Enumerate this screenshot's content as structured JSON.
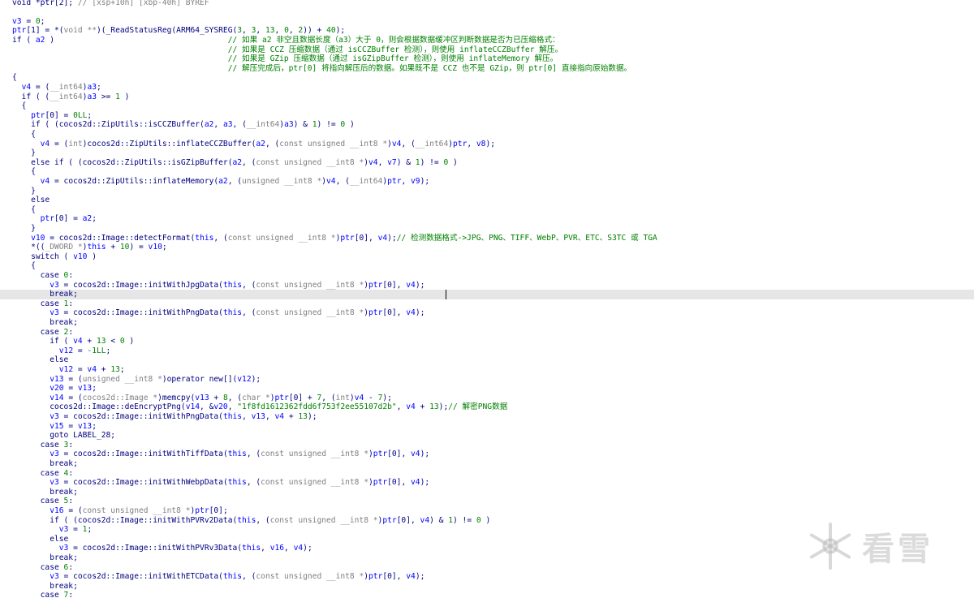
{
  "watermark": {
    "text": "看雪",
    "icon": "snowflake-icon"
  },
  "code_lines": [
    [
      [
        "k",
        "void *ptr[2]; "
      ],
      [
        "t",
        "// [xsp+10h] [xbp-40h] BYREF"
      ]
    ],
    [],
    [
      [
        "v",
        "v3"
      ],
      [
        "k",
        " = "
      ],
      [
        "n",
        "0"
      ],
      [
        "k",
        ";"
      ]
    ],
    [
      [
        "v",
        "ptr"
      ],
      [
        "k",
        "[1] = *("
      ],
      [
        "t",
        "void **"
      ],
      [
        "k",
        ")(_ReadStatusReg(ARM64_SYSREG("
      ],
      [
        "n",
        "3"
      ],
      [
        "k",
        ", "
      ],
      [
        "n",
        "3"
      ],
      [
        "k",
        ", "
      ],
      [
        "n",
        "13"
      ],
      [
        "k",
        ", "
      ],
      [
        "n",
        "0"
      ],
      [
        "k",
        ", "
      ],
      [
        "n",
        "2"
      ],
      [
        "k",
        ")) + "
      ],
      [
        "n",
        "40"
      ],
      [
        "k",
        ");"
      ]
    ],
    [
      [
        "k",
        "if ( "
      ],
      [
        "v",
        "a2"
      ],
      [
        "k",
        " )                                     "
      ],
      [
        "c",
        "// 如果 a2 非空且数据长度（a3）大于 0，则会根据数据缓冲区判断数据是否为已压缩格式："
      ]
    ],
    [
      [
        "k",
        "                                              "
      ],
      [
        "c",
        "// 如果是 CCZ 压缩数据（通过 isCCZBuffer 检测），则使用 inflateCCZBuffer 解压。"
      ]
    ],
    [
      [
        "k",
        "                                              "
      ],
      [
        "c",
        "// 如果是 GZip 压缩数据（通过 isGZipBuffer 检测），则使用 inflateMemory 解压。"
      ]
    ],
    [
      [
        "k",
        "                                              "
      ],
      [
        "c",
        "// 解压完成后，ptr[0] 将指向解压后的数据。如果既不是 CCZ 也不是 GZip，则 ptr[0] 直接指向原始数据。"
      ]
    ],
    [
      [
        "k",
        "{"
      ]
    ],
    [
      [
        "k",
        "  "
      ],
      [
        "v",
        "v4"
      ],
      [
        "k",
        " = ("
      ],
      [
        "t",
        "__int64"
      ],
      [
        "k",
        ")"
      ],
      [
        "v",
        "a3"
      ],
      [
        "k",
        ";"
      ]
    ],
    [
      [
        "k",
        "  if ( ("
      ],
      [
        "t",
        "__int64"
      ],
      [
        "k",
        ")"
      ],
      [
        "v",
        "a3"
      ],
      [
        "k",
        " >= "
      ],
      [
        "n",
        "1"
      ],
      [
        "k",
        " )"
      ]
    ],
    [
      [
        "k",
        "  {"
      ]
    ],
    [
      [
        "k",
        "    "
      ],
      [
        "v",
        "ptr"
      ],
      [
        "k",
        "[0] = "
      ],
      [
        "n",
        "0LL"
      ],
      [
        "k",
        ";"
      ]
    ],
    [
      [
        "k",
        "    if ( (cocos2d::ZipUtils::isCCZBuffer("
      ],
      [
        "v",
        "a2"
      ],
      [
        "k",
        ", "
      ],
      [
        "v",
        "a3"
      ],
      [
        "k",
        ", ("
      ],
      [
        "t",
        "__int64"
      ],
      [
        "k",
        ")"
      ],
      [
        "v",
        "a3"
      ],
      [
        "k",
        ") & "
      ],
      [
        "n",
        "1"
      ],
      [
        "k",
        ") != "
      ],
      [
        "n",
        "0"
      ],
      [
        "k",
        " )"
      ]
    ],
    [
      [
        "k",
        "    {"
      ]
    ],
    [
      [
        "k",
        "      "
      ],
      [
        "v",
        "v4"
      ],
      [
        "k",
        " = ("
      ],
      [
        "t",
        "int"
      ],
      [
        "k",
        ")cocos2d::ZipUtils::inflateCCZBuffer("
      ],
      [
        "v",
        "a2"
      ],
      [
        "k",
        ", ("
      ],
      [
        "t",
        "const unsigned __int8 *"
      ],
      [
        "k",
        ")"
      ],
      [
        "v",
        "v4"
      ],
      [
        "k",
        ", ("
      ],
      [
        "t",
        "__int64"
      ],
      [
        "k",
        ")"
      ],
      [
        "v",
        "ptr"
      ],
      [
        "k",
        ", "
      ],
      [
        "v",
        "v8"
      ],
      [
        "k",
        ");"
      ]
    ],
    [
      [
        "k",
        "    }"
      ]
    ],
    [
      [
        "k",
        "    else if ( (cocos2d::ZipUtils::isGZipBuffer("
      ],
      [
        "v",
        "a2"
      ],
      [
        "k",
        ", ("
      ],
      [
        "t",
        "const unsigned __int8 *"
      ],
      [
        "k",
        ")"
      ],
      [
        "v",
        "v4"
      ],
      [
        "k",
        ", "
      ],
      [
        "v",
        "v7"
      ],
      [
        "k",
        ") & "
      ],
      [
        "n",
        "1"
      ],
      [
        "k",
        ") != "
      ],
      [
        "n",
        "0"
      ],
      [
        "k",
        " )"
      ]
    ],
    [
      [
        "k",
        "    {"
      ]
    ],
    [
      [
        "k",
        "      "
      ],
      [
        "v",
        "v4"
      ],
      [
        "k",
        " = cocos2d::ZipUtils::inflateMemory("
      ],
      [
        "v",
        "a2"
      ],
      [
        "k",
        ", ("
      ],
      [
        "t",
        "unsigned __int8 *"
      ],
      [
        "k",
        ")"
      ],
      [
        "v",
        "v4"
      ],
      [
        "k",
        ", ("
      ],
      [
        "t",
        "__int64"
      ],
      [
        "k",
        ")"
      ],
      [
        "v",
        "ptr"
      ],
      [
        "k",
        ", "
      ],
      [
        "v",
        "v9"
      ],
      [
        "k",
        ");"
      ]
    ],
    [
      [
        "k",
        "    }"
      ]
    ],
    [
      [
        "k",
        "    else"
      ]
    ],
    [
      [
        "k",
        "    {"
      ]
    ],
    [
      [
        "k",
        "      "
      ],
      [
        "v",
        "ptr"
      ],
      [
        "k",
        "[0] = "
      ],
      [
        "v",
        "a2"
      ],
      [
        "k",
        ";"
      ]
    ],
    [
      [
        "k",
        "    }"
      ]
    ],
    [
      [
        "k",
        "    "
      ],
      [
        "v",
        "v10"
      ],
      [
        "k",
        " = cocos2d::Image::detectFormat("
      ],
      [
        "v",
        "this"
      ],
      [
        "k",
        ", ("
      ],
      [
        "t",
        "const unsigned __int8 *"
      ],
      [
        "k",
        ")"
      ],
      [
        "v",
        "ptr"
      ],
      [
        "k",
        "[0], "
      ],
      [
        "v",
        "v4"
      ],
      [
        "k",
        ");"
      ],
      [
        "c",
        "// 检测数据格式->JPG、PNG、TIFF、WebP、PVR、ETC、S3TC 或 TGA"
      ]
    ],
    [
      [
        "k",
        "    *(("
      ],
      [
        "t",
        "_DWORD *"
      ],
      [
        "k",
        ")"
      ],
      [
        "v",
        "this"
      ],
      [
        "k",
        " + "
      ],
      [
        "n",
        "10"
      ],
      [
        "k",
        ") = "
      ],
      [
        "v",
        "v10"
      ],
      [
        "k",
        ";"
      ]
    ],
    [
      [
        "k",
        "    switch ( "
      ],
      [
        "v",
        "v10"
      ],
      [
        "k",
        " )"
      ]
    ],
    [
      [
        "k",
        "    {"
      ]
    ],
    [
      [
        "k",
        "      case "
      ],
      [
        "n",
        "0"
      ],
      [
        "k",
        ":"
      ]
    ],
    [
      [
        "k",
        "        "
      ],
      [
        "v",
        "v3"
      ],
      [
        "k",
        " = cocos2d::Image::initWithJpgData("
      ],
      [
        "v",
        "this"
      ],
      [
        "k",
        ", ("
      ],
      [
        "t",
        "const unsigned __int8 *"
      ],
      [
        "k",
        ")"
      ],
      [
        "v",
        "ptr"
      ],
      [
        "k",
        "[0], "
      ],
      [
        "v",
        "v4"
      ],
      [
        "k",
        ");"
      ]
    ],
    [
      [
        "k",
        "        break;"
      ]
    ],
    [
      [
        "k",
        "      case "
      ],
      [
        "n",
        "1"
      ],
      [
        "k",
        ":"
      ]
    ],
    [
      [
        "k",
        "        "
      ],
      [
        "v",
        "v3"
      ],
      [
        "k",
        " = cocos2d::Image::initWithPngData("
      ],
      [
        "v",
        "this"
      ],
      [
        "k",
        ", ("
      ],
      [
        "t",
        "const unsigned __int8 *"
      ],
      [
        "k",
        ")"
      ],
      [
        "v",
        "ptr"
      ],
      [
        "k",
        "[0], "
      ],
      [
        "v",
        "v4"
      ],
      [
        "k",
        ");"
      ]
    ],
    [
      [
        "k",
        "        break;"
      ]
    ],
    [
      [
        "k",
        "      case "
      ],
      [
        "n",
        "2"
      ],
      [
        "k",
        ":"
      ]
    ],
    [
      [
        "k",
        "        if ( "
      ],
      [
        "v",
        "v4"
      ],
      [
        "k",
        " + "
      ],
      [
        "n",
        "13"
      ],
      [
        "k",
        " < "
      ],
      [
        "n",
        "0"
      ],
      [
        "k",
        " )"
      ]
    ],
    [
      [
        "k",
        "          "
      ],
      [
        "v",
        "v12"
      ],
      [
        "k",
        " = "
      ],
      [
        "n",
        "-1LL"
      ],
      [
        "k",
        ";"
      ]
    ],
    [
      [
        "k",
        "        else"
      ]
    ],
    [
      [
        "k",
        "          "
      ],
      [
        "v",
        "v12"
      ],
      [
        "k",
        " = "
      ],
      [
        "v",
        "v4"
      ],
      [
        "k",
        " + "
      ],
      [
        "n",
        "13"
      ],
      [
        "k",
        ";"
      ]
    ],
    [
      [
        "k",
        "        "
      ],
      [
        "v",
        "v13"
      ],
      [
        "k",
        " = ("
      ],
      [
        "t",
        "unsigned __int8 *"
      ],
      [
        "k",
        ")operator new[]("
      ],
      [
        "v",
        "v12"
      ],
      [
        "k",
        ");"
      ]
    ],
    [
      [
        "k",
        "        "
      ],
      [
        "v",
        "v20"
      ],
      [
        "k",
        " = "
      ],
      [
        "v",
        "v13"
      ],
      [
        "k",
        ";"
      ]
    ],
    [
      [
        "k",
        "        "
      ],
      [
        "v",
        "v14"
      ],
      [
        "k",
        " = ("
      ],
      [
        "t",
        "cocos2d::Image *"
      ],
      [
        "k",
        ")memcpy("
      ],
      [
        "v",
        "v13"
      ],
      [
        "k",
        " + "
      ],
      [
        "n",
        "8"
      ],
      [
        "k",
        ", ("
      ],
      [
        "t",
        "char *"
      ],
      [
        "k",
        ")"
      ],
      [
        "v",
        "ptr"
      ],
      [
        "k",
        "[0] + "
      ],
      [
        "n",
        "7"
      ],
      [
        "k",
        ", ("
      ],
      [
        "t",
        "int"
      ],
      [
        "k",
        ")"
      ],
      [
        "v",
        "v4"
      ],
      [
        "k",
        " - "
      ],
      [
        "n",
        "7"
      ],
      [
        "k",
        ");"
      ]
    ],
    [
      [
        "k",
        "        cocos2d::Image::deEncryptPng("
      ],
      [
        "v",
        "v14"
      ],
      [
        "k",
        ", &"
      ],
      [
        "v",
        "v20"
      ],
      [
        "k",
        ", "
      ],
      [
        "s",
        "\"1f8fd1612362fdd6f753f2ee55107d2b\""
      ],
      [
        "k",
        ", "
      ],
      [
        "v",
        "v4"
      ],
      [
        "k",
        " + "
      ],
      [
        "n",
        "13"
      ],
      [
        "k",
        ");"
      ],
      [
        "c",
        "// 解密PNG数据"
      ]
    ],
    [
      [
        "k",
        "        "
      ],
      [
        "v",
        "v3"
      ],
      [
        "k",
        " = cocos2d::Image::initWithPngData("
      ],
      [
        "v",
        "this"
      ],
      [
        "k",
        ", "
      ],
      [
        "v",
        "v13"
      ],
      [
        "k",
        ", "
      ],
      [
        "v",
        "v4"
      ],
      [
        "k",
        " + "
      ],
      [
        "n",
        "13"
      ],
      [
        "k",
        ");"
      ]
    ],
    [
      [
        "k",
        "        "
      ],
      [
        "v",
        "v15"
      ],
      [
        "k",
        " = "
      ],
      [
        "v",
        "v13"
      ],
      [
        "k",
        ";"
      ]
    ],
    [
      [
        "k",
        "        goto LABEL_28;"
      ]
    ],
    [
      [
        "k",
        "      case "
      ],
      [
        "n",
        "3"
      ],
      [
        "k",
        ":"
      ]
    ],
    [
      [
        "k",
        "        "
      ],
      [
        "v",
        "v3"
      ],
      [
        "k",
        " = cocos2d::Image::initWithTiffData("
      ],
      [
        "v",
        "this"
      ],
      [
        "k",
        ", ("
      ],
      [
        "t",
        "const unsigned __int8 *"
      ],
      [
        "k",
        ")"
      ],
      [
        "v",
        "ptr"
      ],
      [
        "k",
        "[0], "
      ],
      [
        "v",
        "v4"
      ],
      [
        "k",
        ");"
      ]
    ],
    [
      [
        "k",
        "        break;"
      ]
    ],
    [
      [
        "k",
        "      case "
      ],
      [
        "n",
        "4"
      ],
      [
        "k",
        ":"
      ]
    ],
    [
      [
        "k",
        "        "
      ],
      [
        "v",
        "v3"
      ],
      [
        "k",
        " = cocos2d::Image::initWithWebpData("
      ],
      [
        "v",
        "this"
      ],
      [
        "k",
        ", ("
      ],
      [
        "t",
        "const unsigned __int8 *"
      ],
      [
        "k",
        ")"
      ],
      [
        "v",
        "ptr"
      ],
      [
        "k",
        "[0], "
      ],
      [
        "v",
        "v4"
      ],
      [
        "k",
        ");"
      ]
    ],
    [
      [
        "k",
        "        break;"
      ]
    ],
    [
      [
        "k",
        "      case "
      ],
      [
        "n",
        "5"
      ],
      [
        "k",
        ":"
      ]
    ],
    [
      [
        "k",
        "        "
      ],
      [
        "v",
        "v16"
      ],
      [
        "k",
        " = ("
      ],
      [
        "t",
        "const unsigned __int8 *"
      ],
      [
        "k",
        ")"
      ],
      [
        "v",
        "ptr"
      ],
      [
        "k",
        "[0];"
      ]
    ],
    [
      [
        "k",
        "        if ( (cocos2d::Image::initWithPVRv2Data("
      ],
      [
        "v",
        "this"
      ],
      [
        "k",
        ", ("
      ],
      [
        "t",
        "const unsigned __int8 *"
      ],
      [
        "k",
        ")"
      ],
      [
        "v",
        "ptr"
      ],
      [
        "k",
        "[0], "
      ],
      [
        "v",
        "v4"
      ],
      [
        "k",
        ") & "
      ],
      [
        "n",
        "1"
      ],
      [
        "k",
        ") != "
      ],
      [
        "n",
        "0"
      ],
      [
        "k",
        " )"
      ]
    ],
    [
      [
        "k",
        "          "
      ],
      [
        "v",
        "v3"
      ],
      [
        "k",
        " = "
      ],
      [
        "n",
        "1"
      ],
      [
        "k",
        ";"
      ]
    ],
    [
      [
        "k",
        "        else"
      ]
    ],
    [
      [
        "k",
        "          "
      ],
      [
        "v",
        "v3"
      ],
      [
        "k",
        " = cocos2d::Image::initWithPVRv3Data("
      ],
      [
        "v",
        "this"
      ],
      [
        "k",
        ", "
      ],
      [
        "v",
        "v16"
      ],
      [
        "k",
        ", "
      ],
      [
        "v",
        "v4"
      ],
      [
        "k",
        ");"
      ]
    ],
    [
      [
        "k",
        "        break;"
      ]
    ],
    [
      [
        "k",
        "      case "
      ],
      [
        "n",
        "6"
      ],
      [
        "k",
        ":"
      ]
    ],
    [
      [
        "k",
        "        "
      ],
      [
        "v",
        "v3"
      ],
      [
        "k",
        " = cocos2d::Image::initWithETCData("
      ],
      [
        "v",
        "this"
      ],
      [
        "k",
        ", ("
      ],
      [
        "t",
        "const unsigned __int8 *"
      ],
      [
        "k",
        ")"
      ],
      [
        "v",
        "ptr"
      ],
      [
        "k",
        "[0], "
      ],
      [
        "v",
        "v4"
      ],
      [
        "k",
        ");"
      ]
    ],
    [
      [
        "k",
        "        break;"
      ]
    ],
    [
      [
        "k",
        "      case "
      ],
      [
        "n",
        "7"
      ],
      [
        "k",
        ":"
      ]
    ]
  ]
}
